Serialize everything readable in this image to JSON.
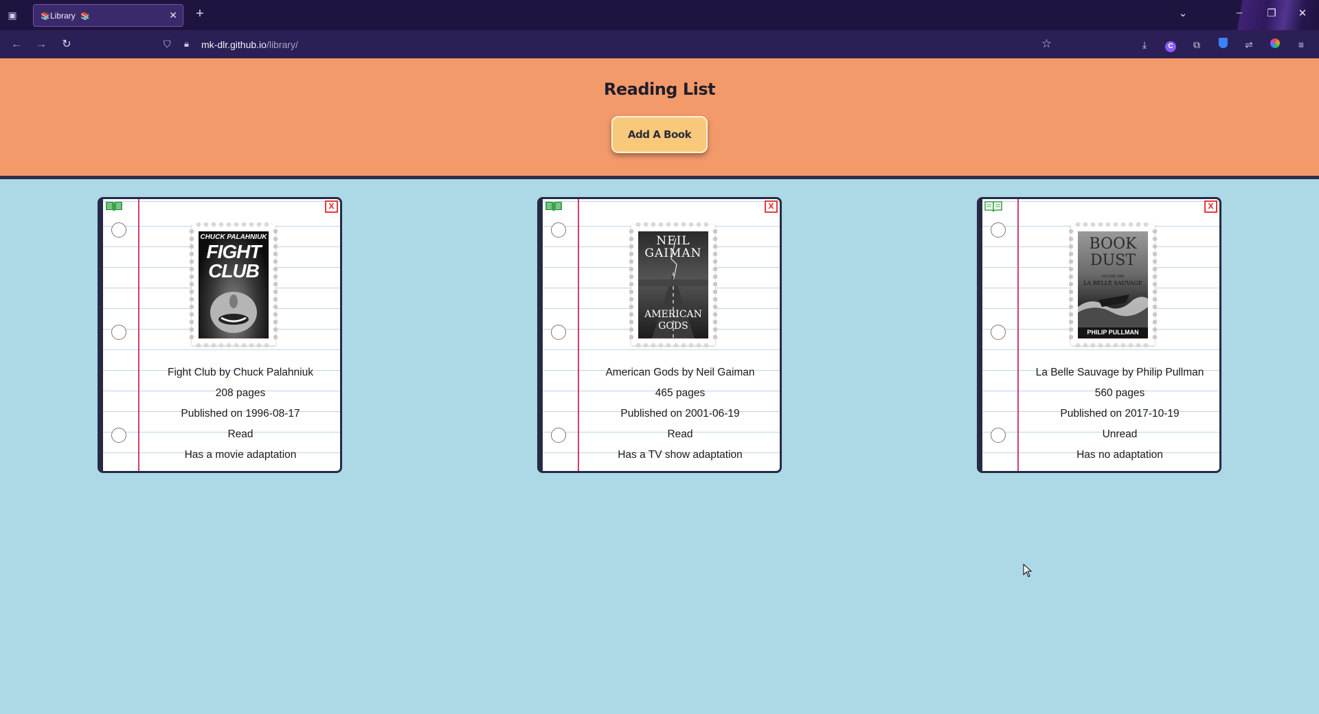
{
  "browser": {
    "tab_title": "Library",
    "tab_close": "✕",
    "new_tab": "+",
    "url_host": "mk-dlr.github.io",
    "url_path": "/library/",
    "icons": [
      "tab-list-icon",
      "back-icon",
      "forward-icon",
      "reload-icon",
      "shield-icon",
      "lock-icon",
      "star-icon",
      "download-icon",
      "extension-icon",
      "puzzle-icon",
      "bitwarden-icon",
      "sync-icon",
      "color-icon",
      "menu-icon"
    ]
  },
  "page": {
    "title": "Reading List",
    "add_button": "Add A Book"
  },
  "colors": {
    "header_bg": "#f39a6b",
    "page_bg": "#add8e6",
    "button_bg": "#f8c97b",
    "margin_line": "#d63a6b",
    "delete_red": "#e23a3a",
    "read_green": "#3aa34a"
  },
  "books": [
    {
      "title_line": "Fight Club by Chuck Palahniuk",
      "pages": "208 pages",
      "published": "Published on 1996-08-17",
      "status": "Read",
      "adaptation": "Has a movie adaptation",
      "delete_label": "X",
      "cover": {
        "author": "CHUCK PALAHNIUK",
        "line1": "FIGHT",
        "line2": "CLUB"
      }
    },
    {
      "title_line": "American Gods by Neil Gaiman",
      "pages": "465 pages",
      "published": "Published on 2001-06-19",
      "status": "Read",
      "adaptation": "Has a TV show adaptation",
      "delete_label": "X",
      "cover": {
        "author_line1": "NEIL",
        "author_line2": "GAIMAN",
        "line1": "AMERICAN",
        "line2": "GODS"
      }
    },
    {
      "title_line": "La Belle Sauvage by Philip Pullman",
      "pages": "560 pages",
      "published": "Published on 2017-10-19",
      "status": "Unread",
      "adaptation": "Has no adaptation",
      "delete_label": "X",
      "cover": {
        "line1": "BOOK",
        "line2": "DUST",
        "vol": "VOLUME ONE",
        "sub": "LA BELLE SAUVAGE",
        "author": "PHILIP PULLMAN"
      }
    }
  ]
}
